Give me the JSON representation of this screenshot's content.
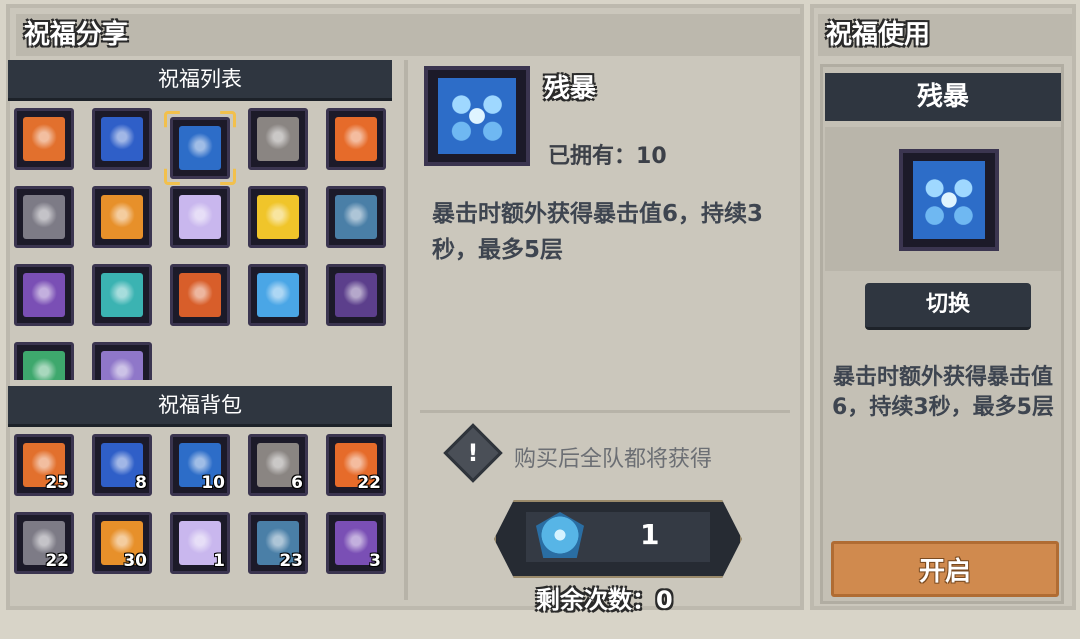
{
  "left_panel": {
    "title": "祝福分享",
    "list_title": "祝福列表",
    "bag_title": "祝福背包"
  },
  "blessing_list": [
    {
      "icon": "fire-burst-icon",
      "color": "#e2702d"
    },
    {
      "icon": "blue-crystal-icon",
      "color": "#2f5fc8"
    },
    {
      "icon": "ice-shield-icon",
      "color": "#2d6dc8",
      "selected": true
    },
    {
      "icon": "grey-tunic-icon",
      "color": "#8a8582"
    },
    {
      "icon": "orange-star-icon",
      "color": "#e66b2a"
    },
    {
      "icon": "crossed-sword-icon",
      "color": "#7d7b86"
    },
    {
      "icon": "orange-chest-icon",
      "color": "#e7902a"
    },
    {
      "icon": "lavender-card-icon",
      "color": "#c9b7ee"
    },
    {
      "icon": "yellow-sparkle-icon",
      "color": "#f0c52a"
    },
    {
      "icon": "tri-orb-icon",
      "color": "#4a7fa7"
    },
    {
      "icon": "purple-banner-icon",
      "color": "#7a4fb5"
    },
    {
      "icon": "gem-trio-icon",
      "color": "#3bb3b2"
    },
    {
      "icon": "flame-wings-icon",
      "color": "#d85e2a"
    },
    {
      "icon": "blue-shard-icon",
      "color": "#4aa6e6"
    },
    {
      "icon": "green-star-icon",
      "color": "#5c3f8c"
    },
    {
      "icon": "green-leaf-icon",
      "color": "#3ea86d"
    },
    {
      "icon": "purple-wing-icon",
      "color": "#8f77c9"
    }
  ],
  "bag_items": [
    {
      "icon": "fire-burst-icon",
      "color": "#e2702d",
      "count": "25"
    },
    {
      "icon": "blue-crystal-icon",
      "color": "#2f5fc8",
      "count": "8"
    },
    {
      "icon": "ice-shield-icon",
      "color": "#2d6dc8",
      "count": "10"
    },
    {
      "icon": "grey-tunic-icon",
      "color": "#8a8582",
      "count": "6"
    },
    {
      "icon": "orange-star-icon",
      "color": "#e66b2a",
      "count": "22"
    },
    {
      "icon": "crossed-sword-icon",
      "color": "#7d7b86",
      "count": "22"
    },
    {
      "icon": "orange-chest-icon",
      "color": "#e7902a",
      "count": "30"
    },
    {
      "icon": "lavender-card-icon",
      "color": "#c9b7ee",
      "count": "1"
    },
    {
      "icon": "tri-orb-icon",
      "color": "#4a7fa7",
      "count": "23"
    },
    {
      "icon": "purple-banner-icon",
      "color": "#7a4fb5",
      "count": "3"
    }
  ],
  "detail": {
    "name": "残暴",
    "owned_label": "已拥有：",
    "owned_count": "10",
    "description": "暴击时额外获得暴击值6，持续3秒，最多5层",
    "notice": "购买后全队都将获得",
    "cost": "1",
    "remaining_label": "剩余次数：",
    "remaining_count": "0"
  },
  "right_panel": {
    "title": "祝福使用",
    "equipped_name": "残暴",
    "switch_label": "切换",
    "description": "暴击时额外获得暴击值6，持续3秒，最多5层",
    "open_label": "开启"
  }
}
